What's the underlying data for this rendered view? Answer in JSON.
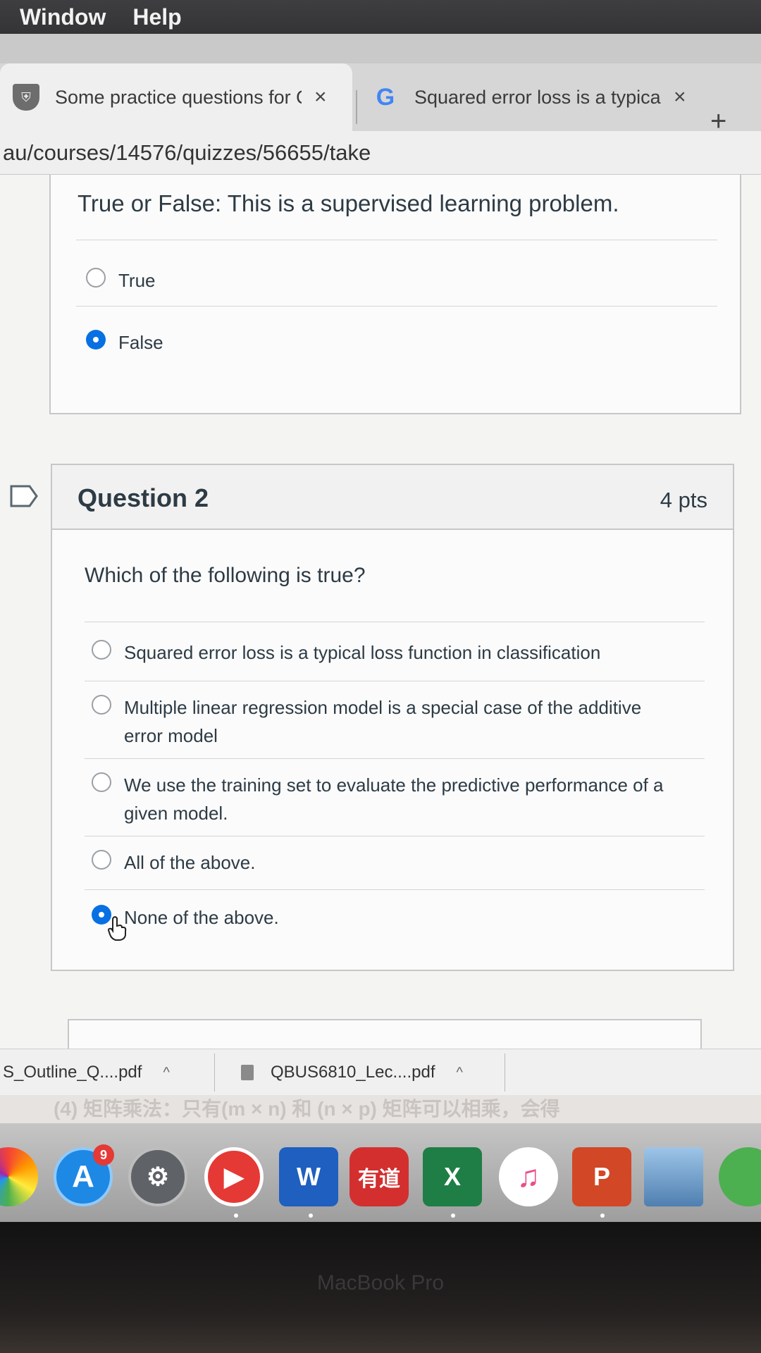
{
  "menubar": {
    "items": [
      "Window",
      "Help"
    ]
  },
  "browser": {
    "tabs": [
      {
        "title": "Some practice questions for Q",
        "close": "×"
      },
      {
        "title": "Squared error loss is a typical l",
        "close": "×"
      }
    ],
    "new_tab": "+",
    "url": "au/courses/14576/quizzes/56655/take"
  },
  "question1": {
    "text": "True or False: This is a supervised learning problem.",
    "options": [
      {
        "label": "True",
        "selected": false
      },
      {
        "label": "False",
        "selected": true
      }
    ]
  },
  "question2": {
    "title": "Question 2",
    "points": "4 pts",
    "text": "Which of the following is true?",
    "options": [
      {
        "label": "Squared error loss is a typical loss function in classification",
        "selected": false
      },
      {
        "label": "Multiple linear regression model is a special case of the additive error model",
        "selected": false
      },
      {
        "label": "We use the training set to evaluate the predictive performance of a given model.",
        "selected": false
      },
      {
        "label": "All of the above.",
        "selected": false
      },
      {
        "label": "None of the above.",
        "selected": true
      }
    ]
  },
  "downloads": [
    {
      "name": "S_Outline_Q....pdf",
      "caret": "^"
    },
    {
      "name": "QBUS6810_Lec....pdf",
      "caret": "^"
    }
  ],
  "background_text": "(4) 矩阵乘法：只有(m × n) 和 (n × p) 矩阵可以相乘，会得",
  "dock": {
    "items": [
      {
        "name": "photos-icon"
      },
      {
        "name": "app-store-icon",
        "badge": "9"
      },
      {
        "name": "system-preferences-icon"
      },
      {
        "name": "video-player-icon"
      },
      {
        "name": "word-icon",
        "text": "W"
      },
      {
        "name": "youdao-icon",
        "text": "有道"
      },
      {
        "name": "excel-icon",
        "text": "X"
      },
      {
        "name": "music-icon"
      },
      {
        "name": "powerpoint-icon",
        "text": "P"
      },
      {
        "name": "preview-icon"
      },
      {
        "name": "wechat-icon"
      }
    ]
  },
  "device_label": "MacBook Pro"
}
